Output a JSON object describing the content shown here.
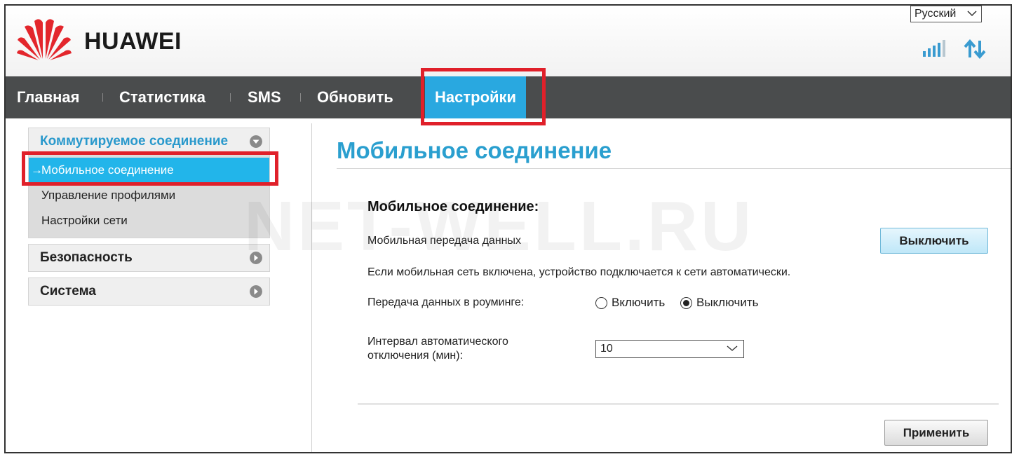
{
  "header": {
    "brand": "HUAWEI",
    "language": "Русский",
    "signal_icon": "signal-bars-icon",
    "data_icon": "data-transfer-arrows-icon"
  },
  "nav": {
    "items": [
      {
        "label": "Главная",
        "active": false
      },
      {
        "label": "Статистика",
        "active": false
      },
      {
        "label": "SMS",
        "active": false
      },
      {
        "label": "Обновить",
        "active": false
      },
      {
        "label": "Настройки",
        "active": true
      }
    ]
  },
  "sidebar": {
    "groups": [
      {
        "label": "Коммутируемое соединение",
        "expanded": true,
        "items": [
          {
            "label": "Мобильное соединение",
            "active": true
          },
          {
            "label": "Управление профилями",
            "active": false
          },
          {
            "label": "Настройки сети",
            "active": false
          }
        ]
      },
      {
        "label": "Безопасность",
        "expanded": false
      },
      {
        "label": "Система",
        "expanded": false
      }
    ]
  },
  "main": {
    "title": "Мобильное соединение",
    "section_title": "Мобильное соединение:",
    "mobile_data_label": "Мобильная передача данных",
    "mobile_data_button": "Выключить",
    "info_text": "Если мобильная сеть включена, устройство подключается к сети автоматически.",
    "roaming_label": "Передача данных в роуминге:",
    "roaming_options": [
      {
        "label": "Включить",
        "selected": false
      },
      {
        "label": "Выключить",
        "selected": true
      }
    ],
    "interval_label_line1": "Интервал автоматического",
    "interval_label_line2": "отключения (мин):",
    "interval_value": "10",
    "apply_button": "Применить"
  },
  "watermark": "NET-WELL.RU",
  "colors": {
    "accent": "#29a8e0",
    "highlight_box": "#e0202a",
    "nav_bg": "#4a4c4d",
    "logo_red": "#e3262c"
  }
}
